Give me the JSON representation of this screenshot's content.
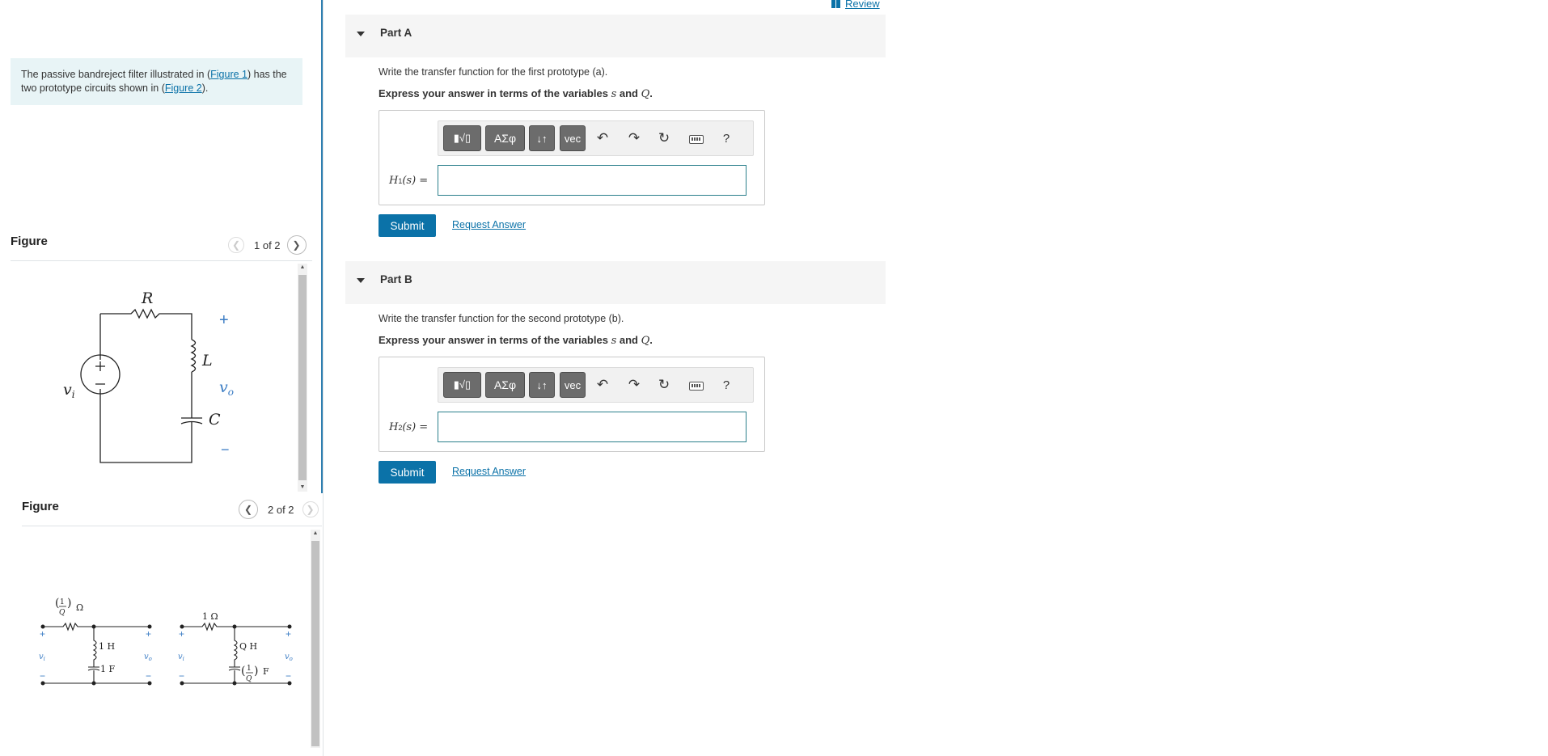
{
  "header": {
    "review_label": "Review"
  },
  "intro": {
    "text_1": "The passive bandreject filter illustrated in (",
    "link_1": "Figure 1",
    "text_2": ") has the two prototype circuits shown in (",
    "link_2": "Figure 2",
    "text_3": ")."
  },
  "figure1": {
    "title": "Figure",
    "pager": "1 of 2",
    "labels": {
      "R": "R",
      "L": "L",
      "C": "C",
      "vi": "v",
      "vi_sub": "i",
      "vo": "v",
      "vo_sub": "o",
      "plus": "+",
      "minus": "−"
    }
  },
  "figure2": {
    "title": "Figure",
    "pager": "2 of 2",
    "labels": {
      "r_a": "Ω",
      "r_b": "1 Ω",
      "l_a": "1 H",
      "c_a": "1 F",
      "l_b": "Q H",
      "c_b": "F",
      "frac_num": "1",
      "frac_den": "Q",
      "vi": "v",
      "vi_sub": "i",
      "vo": "v",
      "vo_sub": "o",
      "plus": "+",
      "minus": "−"
    }
  },
  "parts": [
    {
      "label": "Part A",
      "prompt": "Write the transfer function for the first prototype (a).",
      "instr_pre": "Express your answer in terms of the variables ",
      "var_s": "s",
      "instr_and": " and ",
      "var_q": "Q",
      "instr_post": ".",
      "h_label": "H",
      "h_sub": "1",
      "h_arg": "(s) =",
      "submit": "Submit",
      "request": "Request Answer"
    },
    {
      "label": "Part B",
      "prompt": "Write the transfer function for the second prototype (b).",
      "instr_pre": "Express your answer in terms of the variables ",
      "var_s": "s",
      "instr_and": " and ",
      "var_q": "Q",
      "instr_post": ".",
      "h_label": "H",
      "h_sub": "2",
      "h_arg": "(s) =",
      "submit": "Submit",
      "request": "Request Answer"
    }
  ],
  "toolbar": {
    "templates": "▮√▯",
    "greek": "ΑΣφ",
    "updown": "↓↑",
    "vec": "vec",
    "undo": "↶",
    "redo": "↷",
    "reset": "↻",
    "help": "?"
  },
  "icons": [
    "book-icon",
    "chevron-left-icon",
    "chevron-right-icon",
    "caret-down-icon",
    "undo-icon",
    "redo-icon",
    "reset-icon",
    "keyboard-icon",
    "help-icon"
  ],
  "colors": {
    "accent": "#0b72a8",
    "intro_bg": "#e8f4f6",
    "input_border": "#2b7f8c",
    "circuit_blue": "#3a7cc4"
  }
}
